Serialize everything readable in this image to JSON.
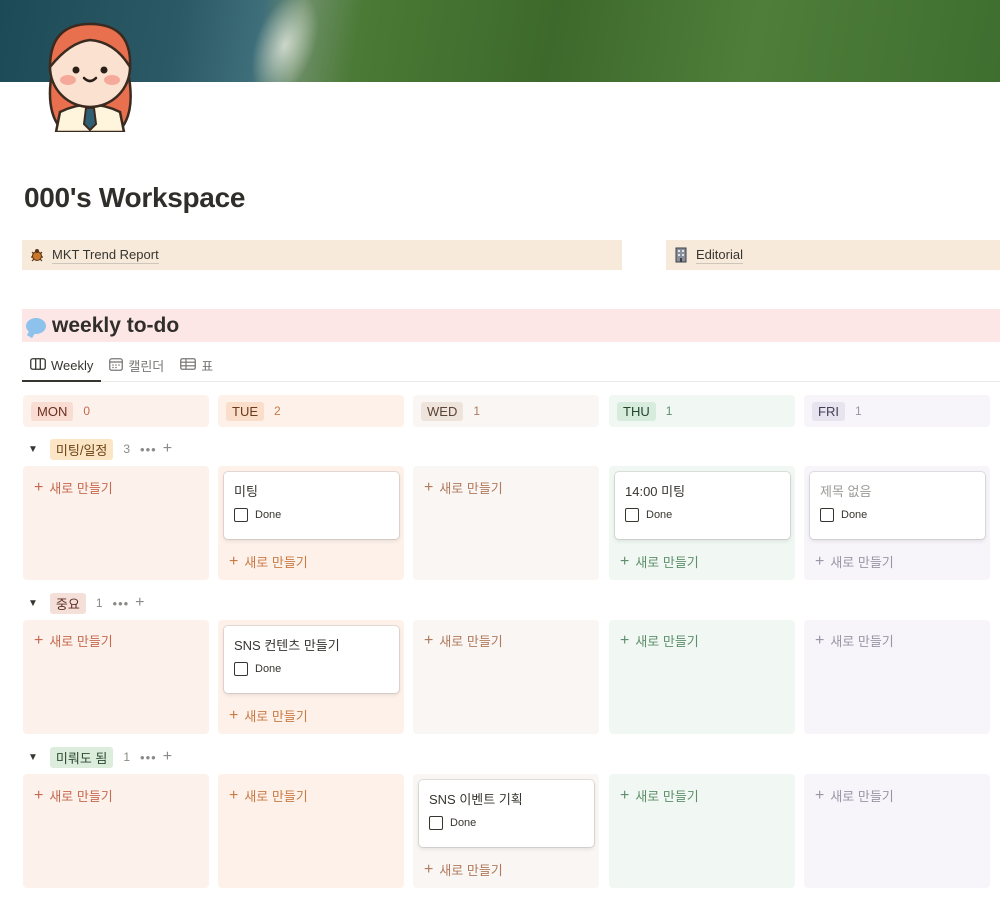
{
  "page": {
    "title": "000's Workspace",
    "links": [
      {
        "icon": "bug-icon",
        "label": "MKT Trend Report"
      },
      {
        "icon": "building-icon",
        "label": "Editorial"
      }
    ]
  },
  "callout": {
    "icon": "speech-bubble-icon",
    "title": "weekly to-do"
  },
  "views": [
    {
      "icon": "board-icon",
      "label": "Weekly",
      "active": true
    },
    {
      "icon": "calendar-icon",
      "label": "캘린더",
      "active": false
    },
    {
      "icon": "table-icon",
      "label": "표",
      "active": false
    }
  ],
  "columns": [
    {
      "label": "MON",
      "count": "0",
      "colors": {
        "bg": "#fdf1ec",
        "tag": "#f9dcd2",
        "text": "#6b2e1e",
        "count": "#c56a4e",
        "new": "#c56a4e"
      }
    },
    {
      "label": "TUE",
      "count": "2",
      "colors": {
        "bg": "#fdf1ea",
        "tag": "#fadec9",
        "text": "#6b3a1b",
        "count": "#c97b45",
        "new": "#c97b45"
      }
    },
    {
      "label": "WED",
      "count": "1",
      "colors": {
        "bg": "#f9f6f3",
        "tag": "#eee4dc",
        "text": "#5a4235",
        "count": "#b07a5e",
        "new": "#b07a5e"
      }
    },
    {
      "label": "THU",
      "count": "1",
      "colors": {
        "bg": "#f1f7f2",
        "tag": "#d7ecdc",
        "text": "#24452c",
        "count": "#5e8f6a",
        "new": "#5e8f6a"
      }
    },
    {
      "label": "FRI",
      "count": "1",
      "colors": {
        "bg": "#f7f5fa",
        "tag": "#e7e3ef",
        "text": "#463d55",
        "count": "#9b95a5",
        "new": "#9b95a5"
      }
    }
  ],
  "groups": [
    {
      "label": "미팅/일정",
      "count": "3",
      "tag_bg": "#fbe5c5",
      "tag_text": "#6b4315"
    },
    {
      "label": "중요",
      "count": "1",
      "tag_bg": "#f5dfd9",
      "tag_text": "#5e2c23"
    },
    {
      "label": "미뤄도 됨",
      "count": "1",
      "tag_bg": "#dcedde",
      "tag_text": "#2b4a30"
    }
  ],
  "cards": [
    {
      "title": "미팅",
      "done_label": "Done",
      "placeholder": false
    },
    {
      "title": "14:00 미팅",
      "done_label": "Done",
      "placeholder": false
    },
    {
      "title": "제목 없음",
      "done_label": "Done",
      "placeholder": true
    },
    {
      "title": "SNS 컨텐츠 만들기",
      "done_label": "Done",
      "placeholder": false
    },
    {
      "title": "SNS 이벤트 기획",
      "done_label": "Done",
      "placeholder": false
    }
  ],
  "new_label": "새로 만들기",
  "more_glyph": "•••",
  "plus_glyph": "+"
}
